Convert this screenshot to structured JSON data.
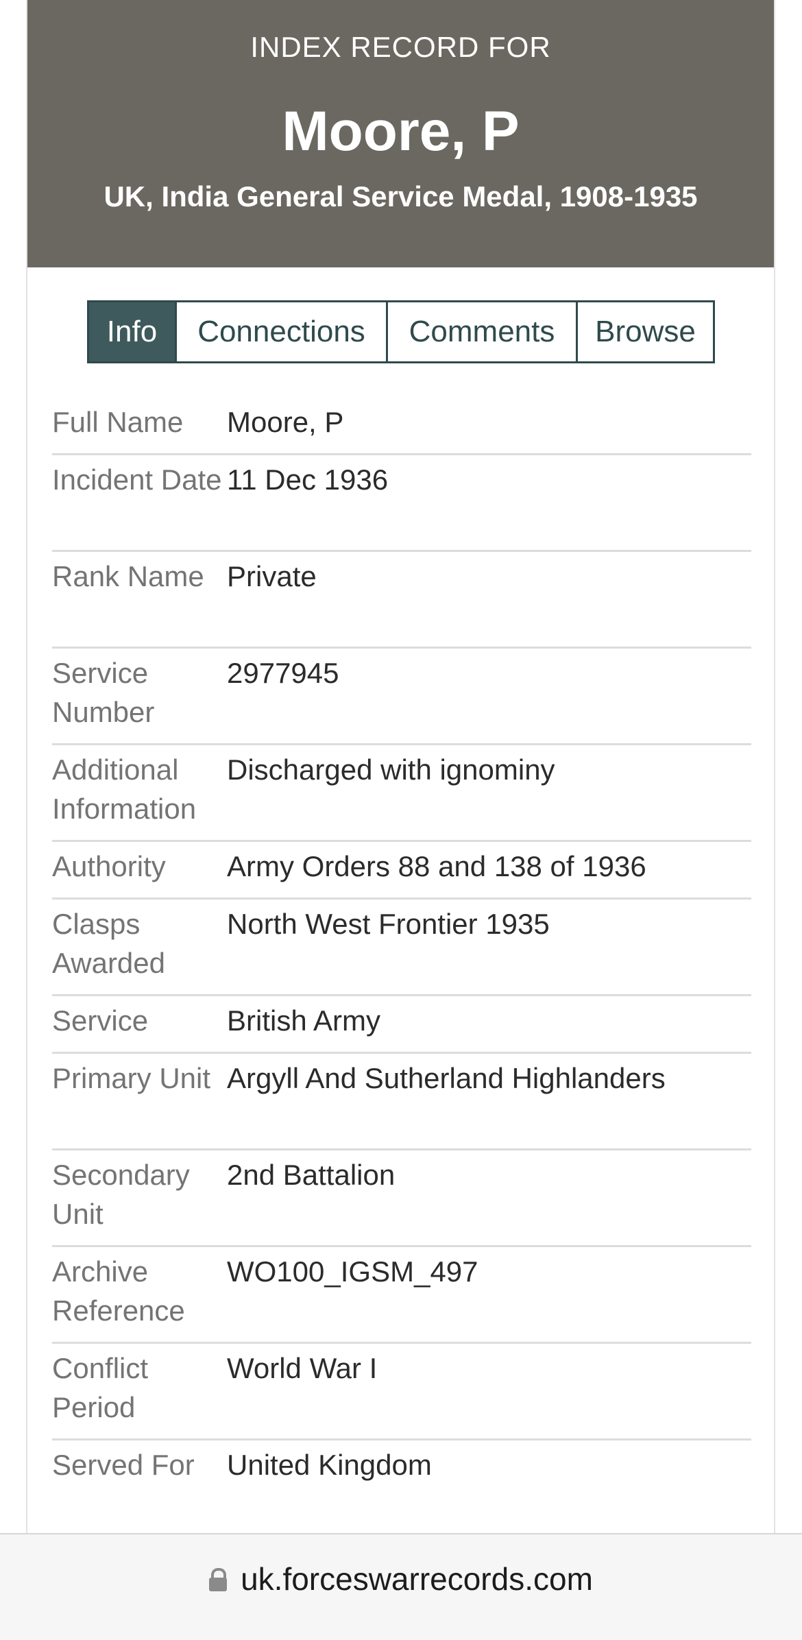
{
  "header": {
    "kicker": "INDEX RECORD FOR",
    "name": "Moore, P",
    "subtitle": "UK, India General Service Medal, 1908-1935"
  },
  "tabs": [
    {
      "label": "Info",
      "active": true
    },
    {
      "label": "Connections",
      "active": false
    },
    {
      "label": "Comments",
      "active": false
    },
    {
      "label": "Browse",
      "active": false
    }
  ],
  "record": [
    {
      "label": "Full Name",
      "value": "Moore, P"
    },
    {
      "label": "Incident Date",
      "value": "11 Dec 1936"
    },
    {
      "label": "Rank Name",
      "value": "Private"
    },
    {
      "label": "Service Number",
      "value": "2977945"
    },
    {
      "label": "Additional Information",
      "value": "Discharged with ignominy"
    },
    {
      "label": "Authority",
      "value": "Army Orders 88 and 138 of 1936"
    },
    {
      "label": "Clasps Awarded",
      "value": "North West Frontier 1935"
    },
    {
      "label": "Service",
      "value": "British Army"
    },
    {
      "label": "Primary Unit",
      "value": "Argyll And Sutherland Highlanders"
    },
    {
      "label": "Secondary Unit",
      "value": "2nd Battalion"
    },
    {
      "label": "Archive Reference",
      "value": "WO100_IGSM_497"
    },
    {
      "label": "Conflict Period",
      "value": "World War I"
    },
    {
      "label": "Served For",
      "value": "United Kingdom"
    }
  ],
  "browser": {
    "url": "uk.forceswarrecords.com",
    "lock_icon": "lock-icon"
  },
  "colors": {
    "header_bg": "#6b6861",
    "tab_active_bg": "#3e5a5c",
    "tab_border": "#2f4a4c"
  }
}
